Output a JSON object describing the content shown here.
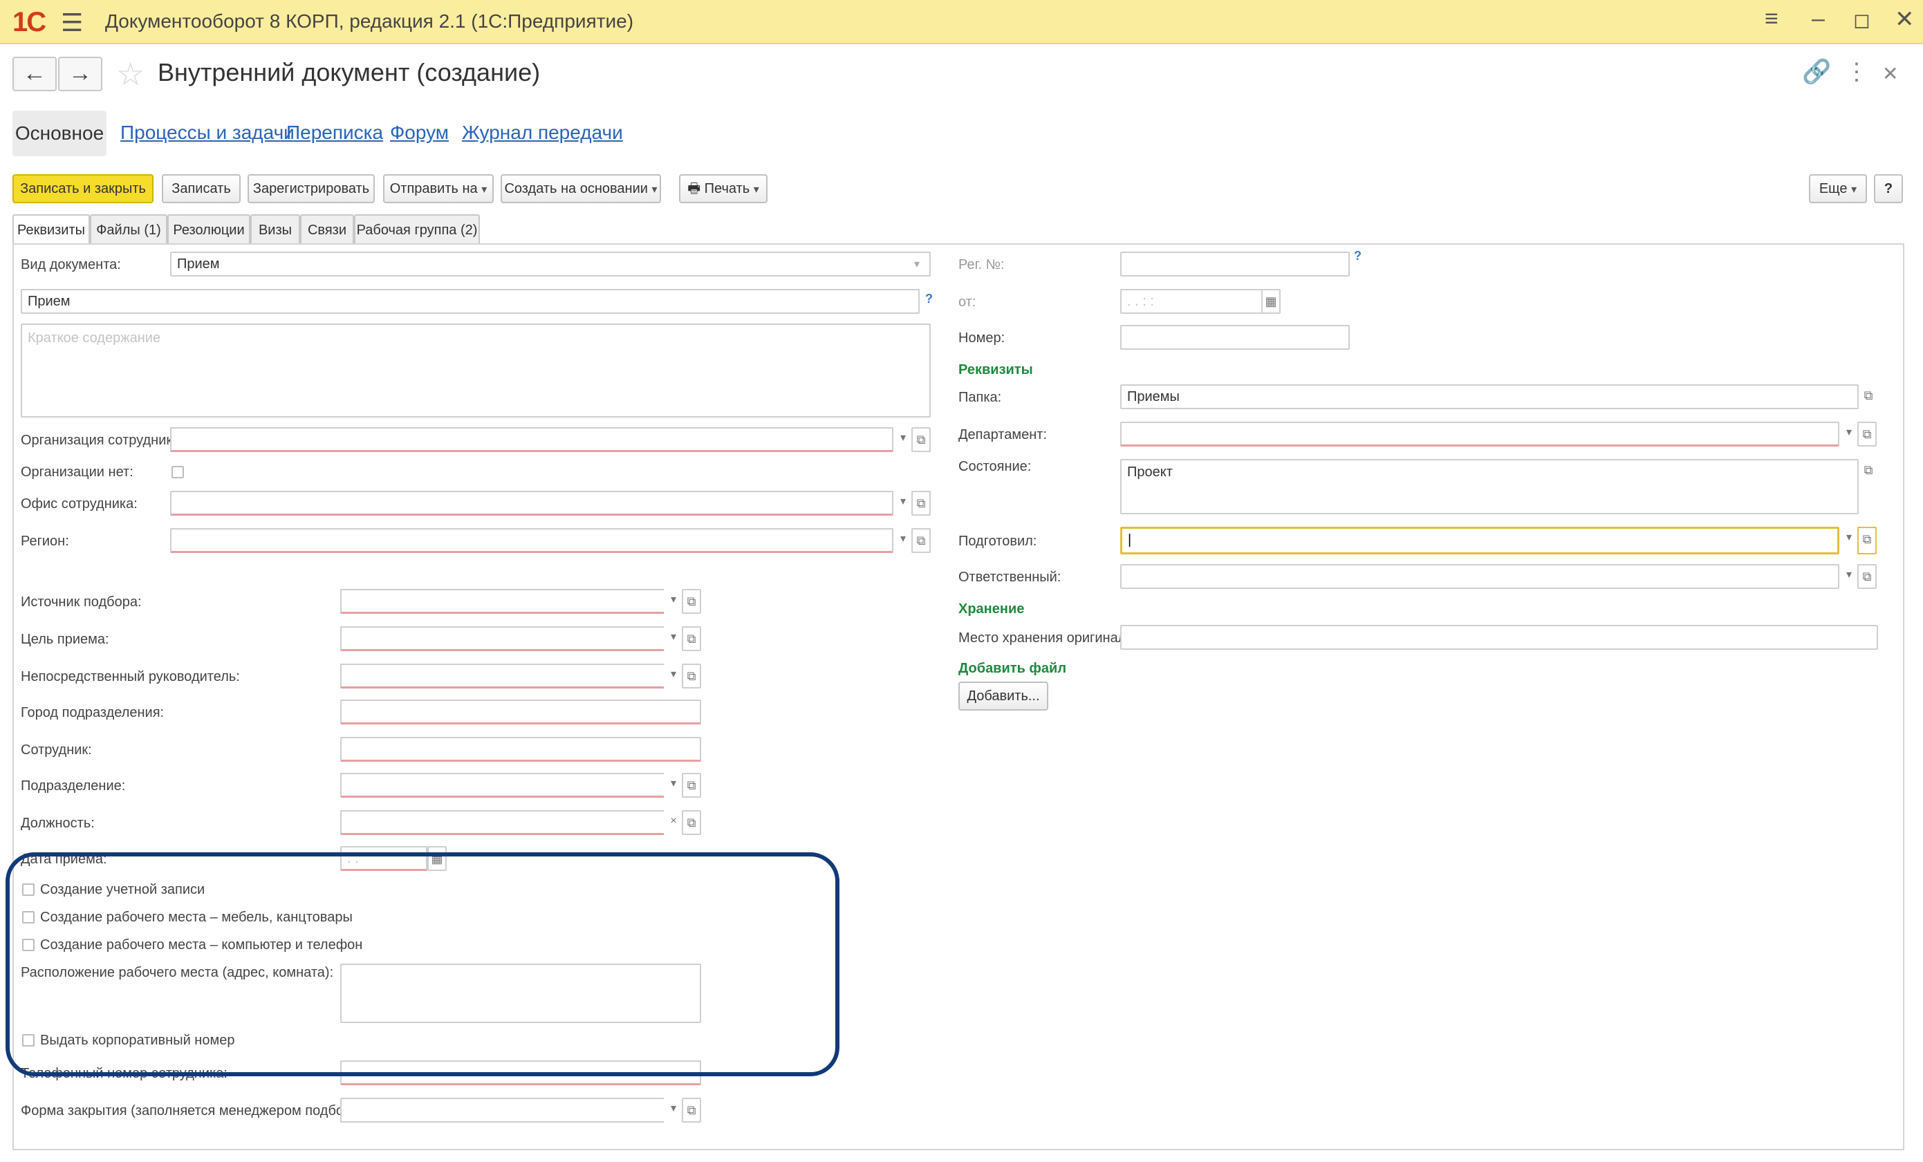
{
  "window": {
    "logo": "1С",
    "title": "Документооборот 8 КОРП, редакция 2.1  (1С:Предприятие)"
  },
  "header": {
    "title": "Внутренний документ (создание)"
  },
  "sections": {
    "main": "Основное",
    "links": [
      "Процессы и задачи",
      "Переписка",
      "Форум",
      "Журнал передачи"
    ]
  },
  "toolbar": {
    "save_close": "Записать и закрыть",
    "save": "Записать",
    "register": "Зарегистрировать",
    "send_to": "Отправить на",
    "create_based": "Создать на основании",
    "print": "Печать",
    "more": "Еще",
    "help": "?"
  },
  "tabs": [
    "Реквизиты",
    "Файлы (1)",
    "Резолюции",
    "Визы",
    "Связи",
    "Рабочая группа (2)"
  ],
  "left": {
    "doc_type_label": "Вид документа:",
    "doc_type_value": "Прием",
    "title_value": "Прием",
    "summary_placeholder": "Краткое содержание",
    "org_label": "Организация сотрудника:",
    "no_org_label": "Организации нет:",
    "office_label": "Офис сотрудника:",
    "region_label": "Регион:",
    "source_label": "Источник подбора:",
    "purpose_label": "Цель приема:",
    "manager_label": "Непосредственный руководитель:",
    "city_label": "Город подразделения:",
    "employee_label": "Сотрудник:",
    "department_label": "Подразделение:",
    "position_label": "Должность:",
    "hire_date_label": "Дата приема:",
    "hire_date_value": "  .  .    ",
    "chk_account": "Создание учетной записи",
    "chk_workplace_furniture": "Создание рабочего места – мебель, канцтовары",
    "chk_workplace_computer": "Создание рабочего места – компьютер и телефон",
    "workplace_location_label": "Расположение рабочего места (адрес, комната):",
    "chk_corp_number": "Выдать корпоративный номер",
    "phone_label": "Телефонный номер сотрудника:",
    "closing_form_label": "Форма закрытия (заполняется менеджером подбора):"
  },
  "right": {
    "reg_no_label": "Рег. №:",
    "from_label": "от:",
    "from_value": " .  .    :  :",
    "number_label": "Номер:",
    "section_details": "Реквизиты",
    "folder_label": "Папка:",
    "folder_value": "Приемы",
    "dept_label": "Департамент:",
    "state_label": "Состояние:",
    "state_value": "Проект",
    "prepared_label": "Подготовил:",
    "responsible_label": "Ответственный:",
    "section_storage": "Хранение",
    "storage_label": "Место хранения оригинала:",
    "section_addfile": "Добавить файл",
    "add_button": "Добавить..."
  },
  "colors": {
    "titlebar": "#fbed9e",
    "primary_button": "#f5dc2a",
    "link": "#2a64b8",
    "section_green": "#1c8a3e",
    "highlight_frame": "#123a78"
  }
}
